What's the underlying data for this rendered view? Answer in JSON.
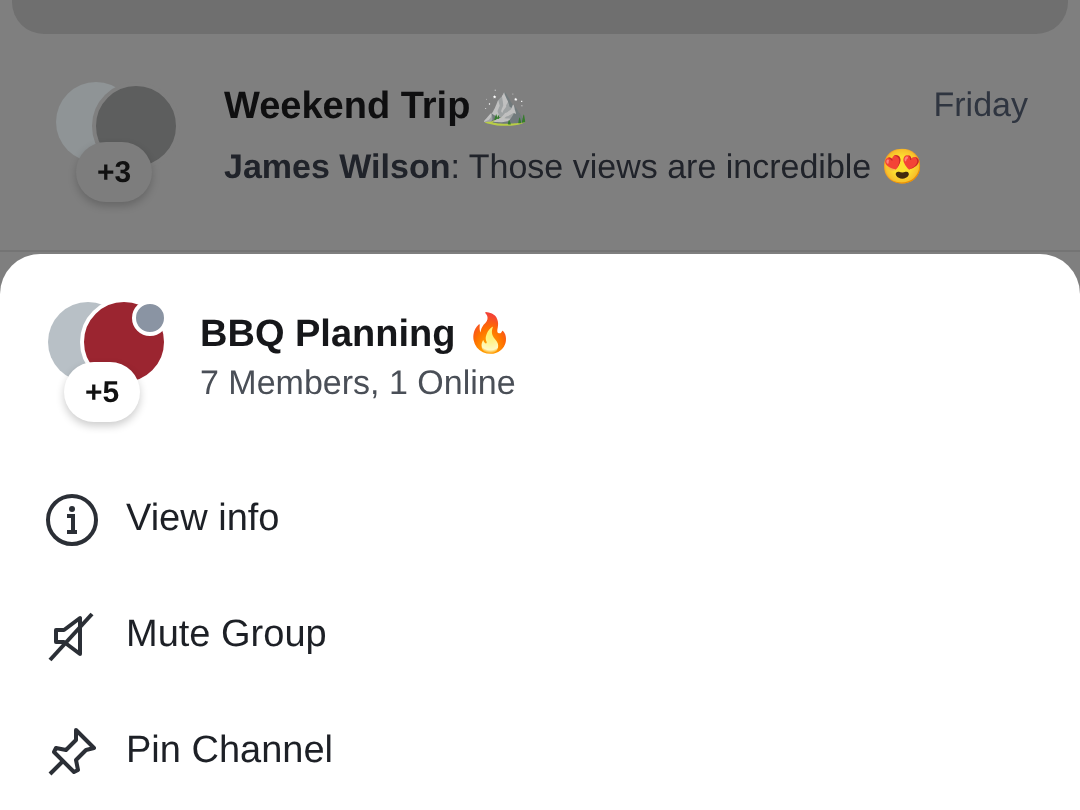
{
  "background_chat": {
    "title": "Weekend Trip ⛰️",
    "time": "Friday",
    "sender": "James Wilson",
    "message": ": Those views are incredible 😍",
    "extra_members": "+3"
  },
  "sheet": {
    "group_name": "BBQ Planning 🔥",
    "members_status": "7 Members, 1 Online",
    "extra_members": "+5",
    "actions": [
      {
        "kind": "info",
        "label": "View info"
      },
      {
        "kind": "mute",
        "label": "Mute Group"
      },
      {
        "kind": "pin",
        "label": "Pin Channel"
      }
    ]
  }
}
